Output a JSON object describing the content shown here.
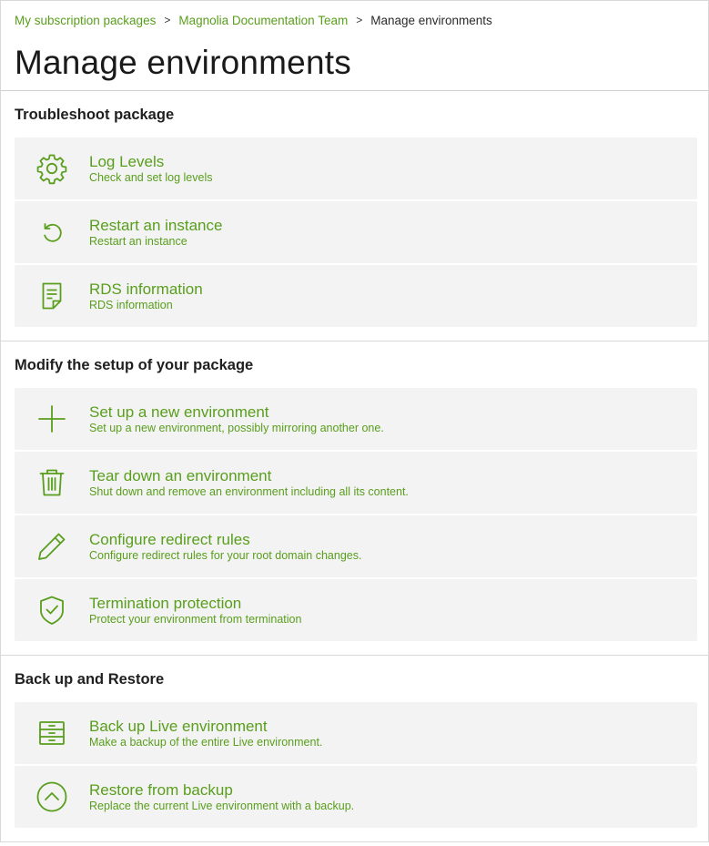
{
  "breadcrumb": {
    "item1": "My subscription packages",
    "item2": "Magnolia Documentation Team",
    "current": "Manage environments",
    "separator": ">"
  },
  "page": {
    "title": "Manage environments"
  },
  "colors": {
    "accent": "#599e1c",
    "card_bg": "#f3f3f3",
    "border": "#d8d8d8"
  },
  "sections": [
    {
      "title": "Troubleshoot package",
      "items": [
        {
          "title": "Log Levels",
          "description": "Check and set log levels",
          "icon": "gear-icon"
        },
        {
          "title": "Restart an instance",
          "description": "Restart an instance",
          "icon": "restart-icon"
        },
        {
          "title": "RDS information",
          "description": "RDS information",
          "icon": "document-icon"
        }
      ]
    },
    {
      "title": "Modify the setup of your package",
      "items": [
        {
          "title": "Set up a new environment",
          "description": "Set up a new environment, possibly mirroring another one.",
          "icon": "plus-icon"
        },
        {
          "title": "Tear down an environment",
          "description": "Shut down and remove an environment including all its content.",
          "icon": "trash-icon"
        },
        {
          "title": "Configure redirect rules",
          "description": "Configure redirect rules for your root domain changes.",
          "icon": "pencil-icon"
        },
        {
          "title": "Termination protection",
          "description": "Protect your environment from termination",
          "icon": "shield-check-icon"
        }
      ]
    },
    {
      "title": "Back up and Restore",
      "items": [
        {
          "title": "Back up Live environment",
          "description": "Make a backup of the entire Live environment.",
          "icon": "server-icon"
        },
        {
          "title": "Restore from backup",
          "description": "Replace the current Live environment with a backup.",
          "icon": "chevron-up-circle-icon"
        }
      ]
    }
  ]
}
